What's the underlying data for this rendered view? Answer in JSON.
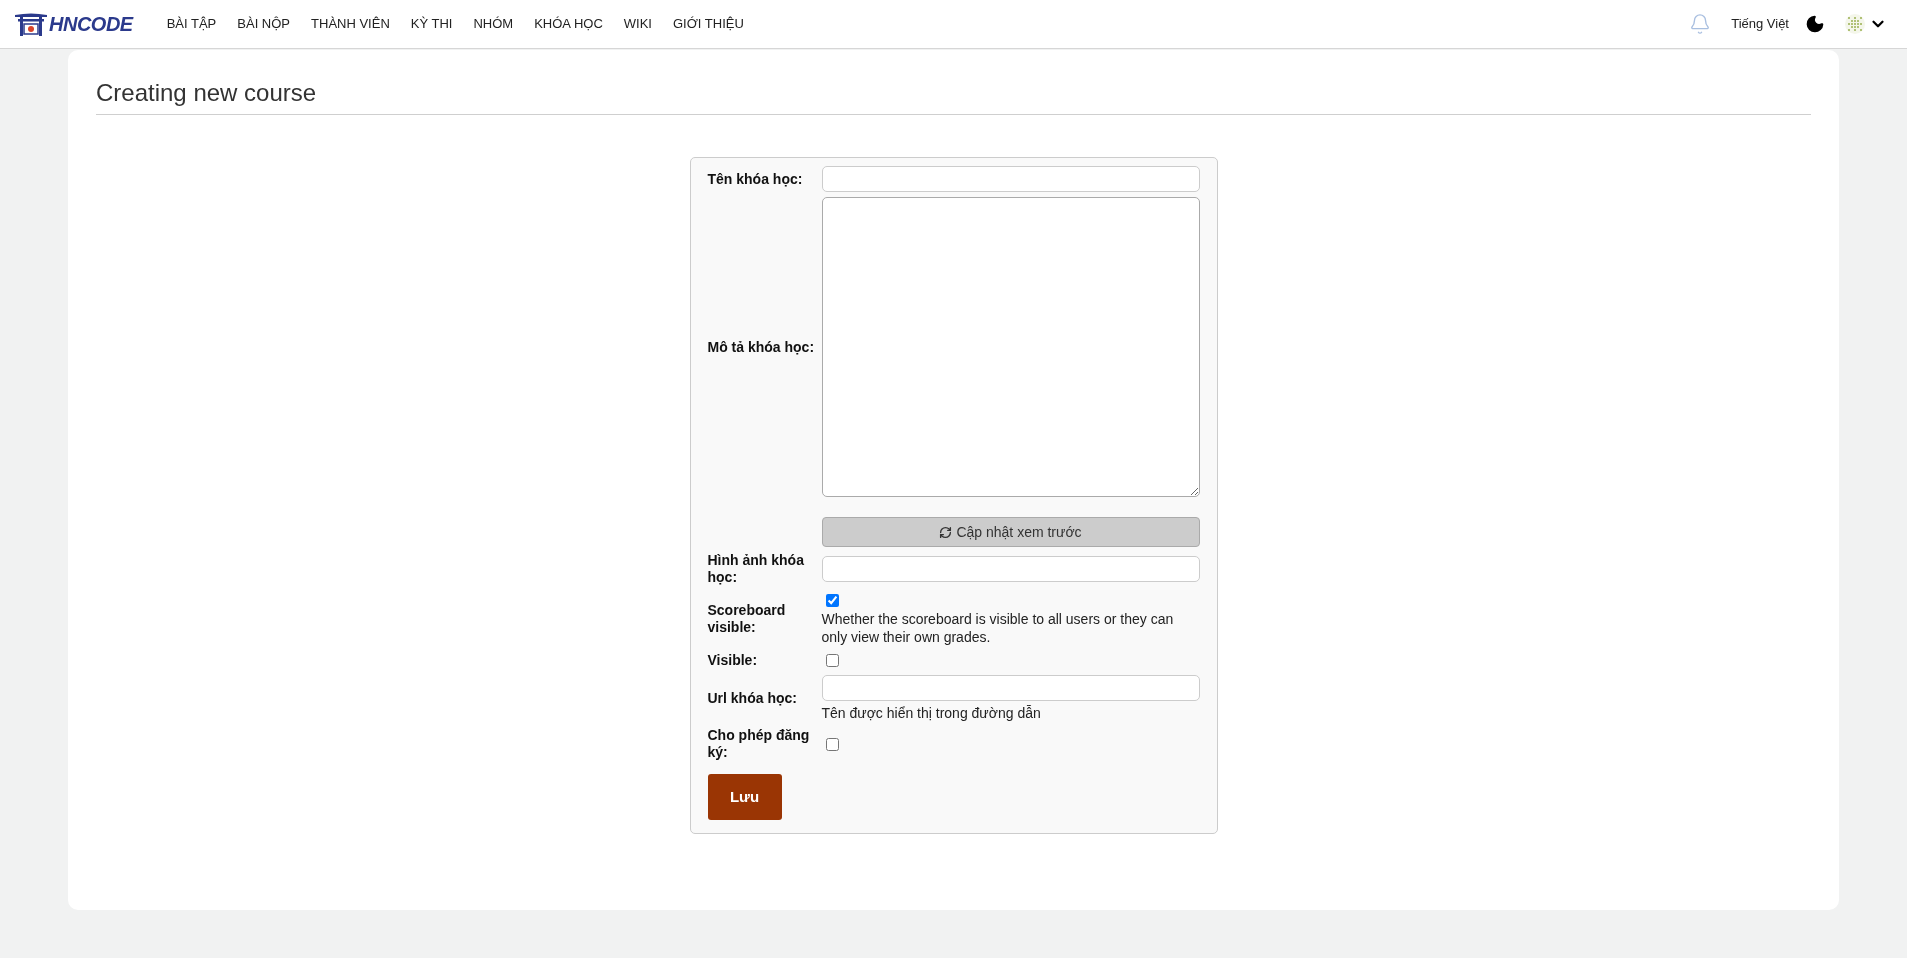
{
  "header": {
    "logo": "HNCODE",
    "nav": [
      "BÀI TẬP",
      "BÀI NỘP",
      "THÀNH VIÊN",
      "KỲ THI",
      "NHÓM",
      "KHÓA HỌC",
      "WIKI",
      "GIỚI THIỆU"
    ],
    "language": "Tiếng Việt"
  },
  "page": {
    "title": "Creating new course"
  },
  "form": {
    "rows": [
      {
        "kind": "text",
        "label": "Tên khóa học:"
      },
      {
        "kind": "textarea",
        "label": "Mô tả khóa học:"
      },
      {
        "kind": "button",
        "label": "Cập nhật xem trước"
      },
      {
        "kind": "text",
        "label": "Hình ảnh khóa học:"
      },
      {
        "kind": "checkbox",
        "label": "Scoreboard visible:",
        "checked": true,
        "help": "Whether the scoreboard is visible to all users or they can only view their own grades."
      },
      {
        "kind": "checkbox",
        "label": "Visible:",
        "checked": false
      },
      {
        "kind": "text",
        "label": "Url khóa học:",
        "help": "Tên được hiển thị trong đường dẫn"
      },
      {
        "kind": "checkbox",
        "label": "Cho phép đăng ký:",
        "checked": false
      }
    ],
    "submit": "Lưu"
  }
}
